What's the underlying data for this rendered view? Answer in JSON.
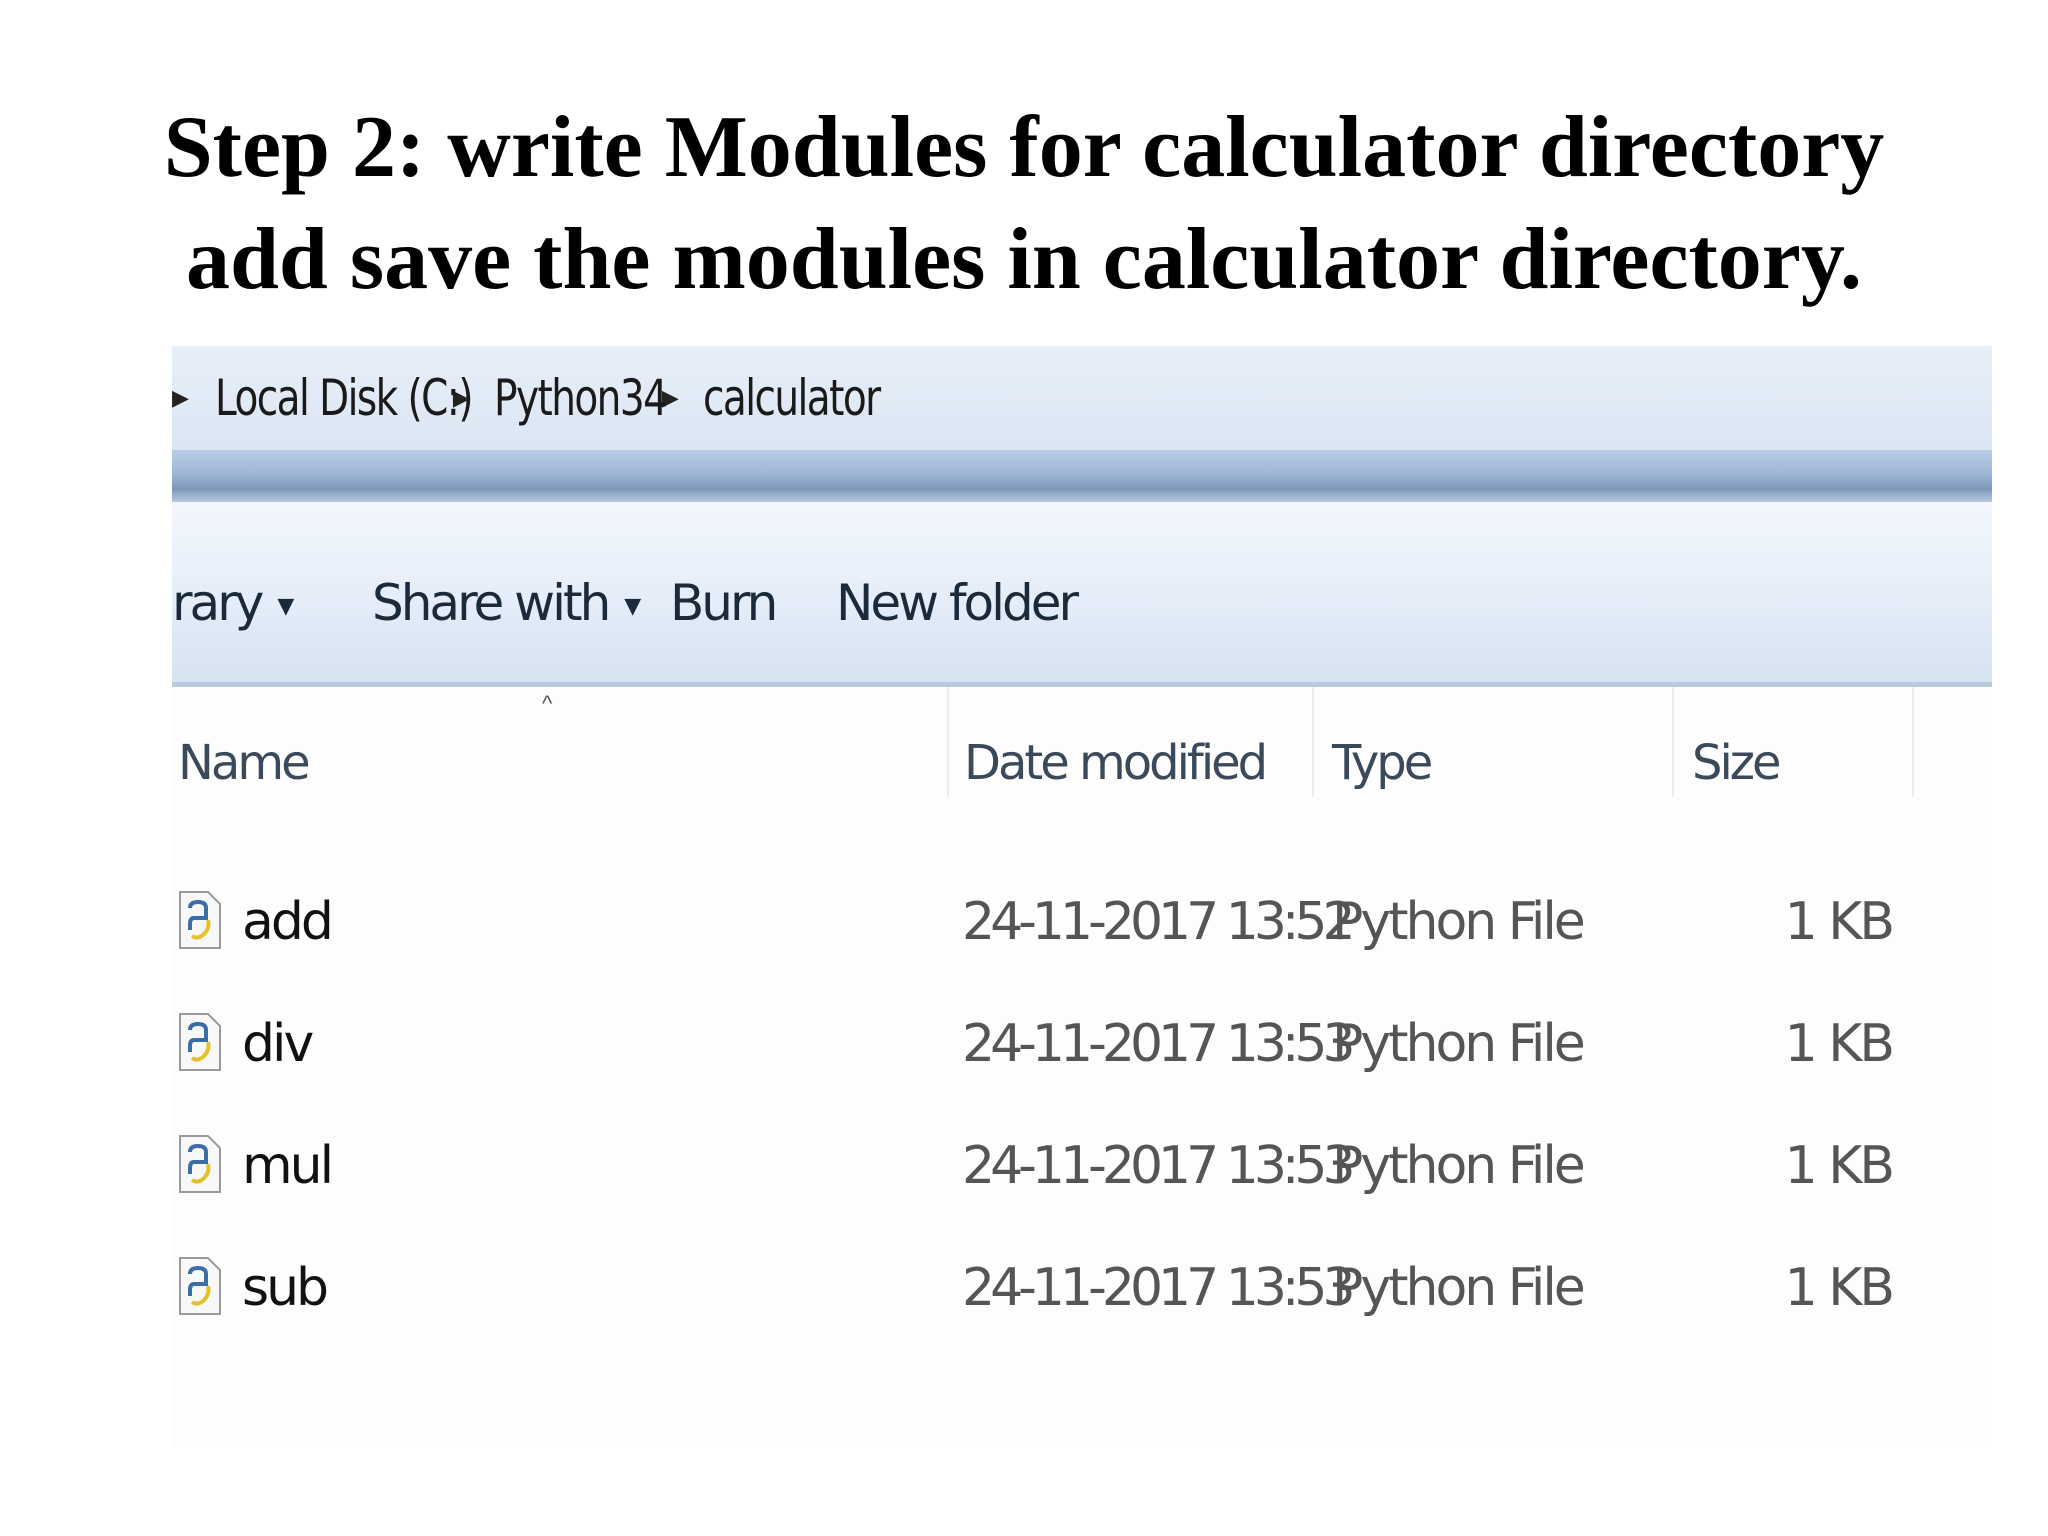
{
  "slide": {
    "title_line1": "Step 2: write Modules for calculator directory",
    "title_line2": "add save the modules in calculator directory."
  },
  "explorer": {
    "breadcrumb": [
      "Local Disk (C:)",
      "Python34",
      "calculator"
    ],
    "toolbar": {
      "library": "rary",
      "share_with": "Share with",
      "burn": "Burn",
      "new_folder": "New folder"
    },
    "columns": {
      "name": "Name",
      "date_modified": "Date modified",
      "type": "Type",
      "size": "Size"
    },
    "files": [
      {
        "name": "add",
        "date": "24-11-2017 13:52",
        "type": "Python File",
        "size": "1 KB"
      },
      {
        "name": "div",
        "date": "24-11-2017 13:53",
        "type": "Python File",
        "size": "1 KB"
      },
      {
        "name": "mul",
        "date": "24-11-2017 13:53",
        "type": "Python File",
        "size": "1 KB"
      },
      {
        "name": "sub",
        "date": "24-11-2017 13:53",
        "type": "Python File",
        "size": "1 KB"
      }
    ],
    "icons": {
      "file": "python-file-icon",
      "breadcrumb_sep": "chevron-right-icon",
      "dropdown": "caret-down-icon",
      "sort": "sort-up-icon"
    }
  }
}
